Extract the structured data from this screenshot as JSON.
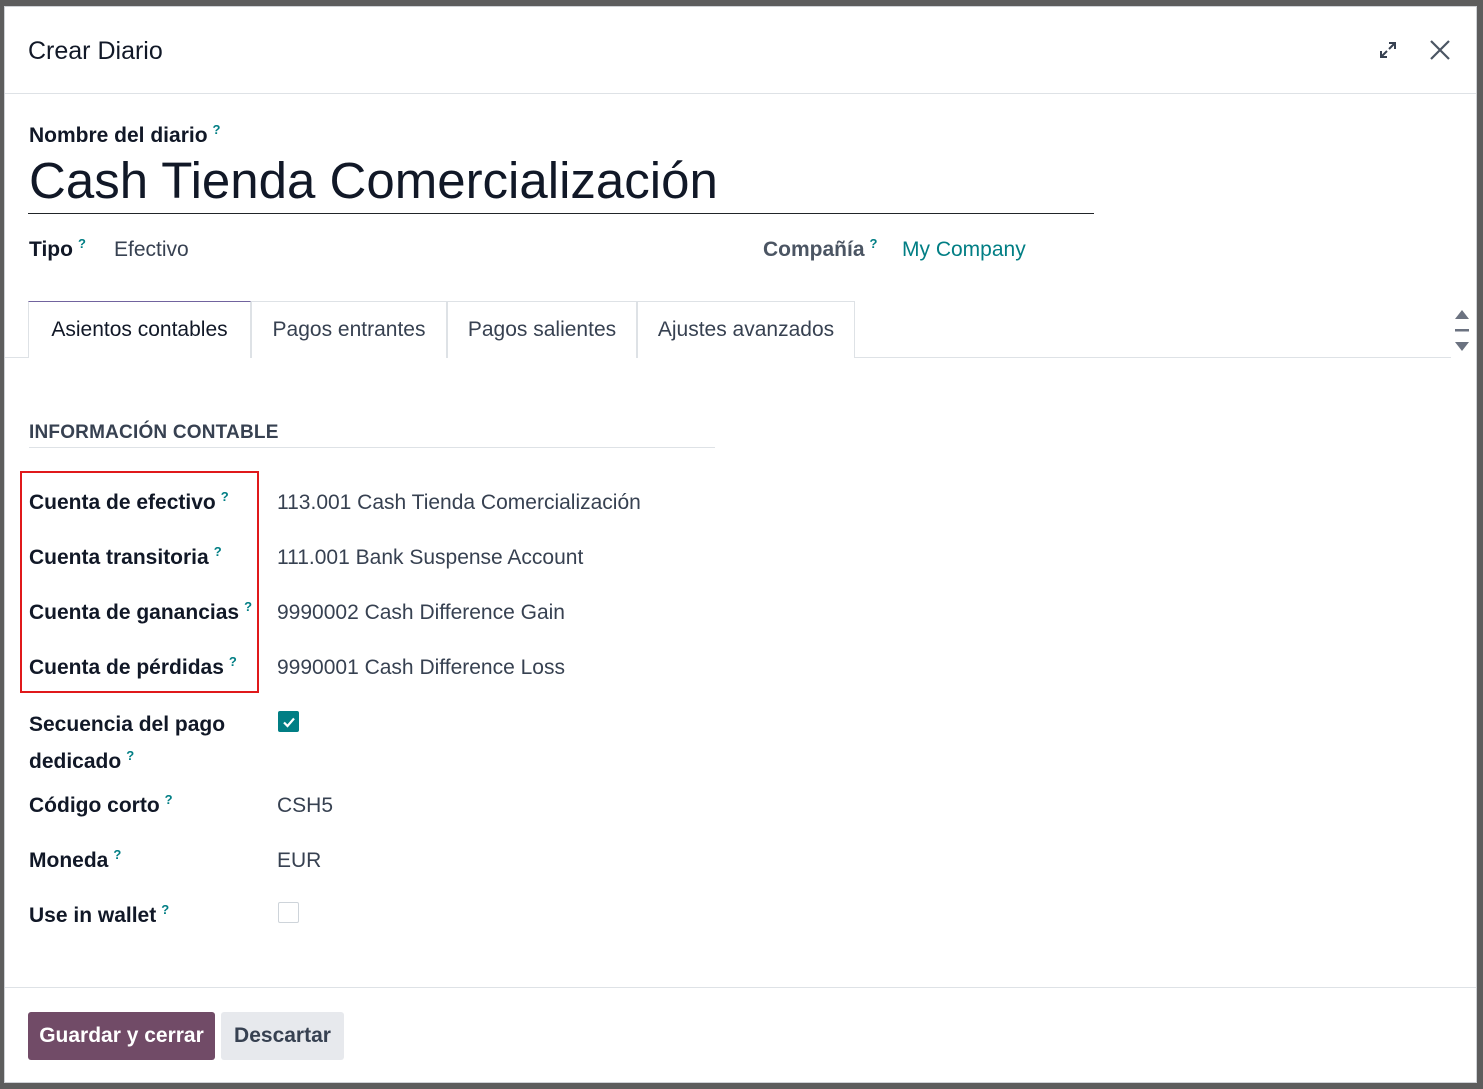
{
  "dialog": {
    "title": "Crear Diario",
    "expand_icon": "expand-icon",
    "close_icon": "close-icon"
  },
  "form": {
    "name_label": "Nombre del diario",
    "name_value": "Cash Tienda Comercialización",
    "tipo_label": "Tipo",
    "tipo_value": "Efectivo",
    "company_label": "Compañía",
    "company_value": "My Company",
    "help_mark": "?"
  },
  "tabs": [
    {
      "label": "Asientos contables",
      "active": true
    },
    {
      "label": "Pagos entrantes",
      "active": false
    },
    {
      "label": "Pagos salientes",
      "active": false
    },
    {
      "label": "Ajustes avanzados",
      "active": false
    }
  ],
  "section": {
    "title": "INFORMACIÓN CONTABLE",
    "fields": {
      "cash_account": {
        "label": "Cuenta de efectivo",
        "value": "113.001 Cash Tienda Comercialización"
      },
      "suspense_account": {
        "label": "Cuenta transitoria",
        "value": "111.001 Bank Suspense Account"
      },
      "profit_account": {
        "label": "Cuenta de ganancias",
        "value": "9990002 Cash Difference Gain"
      },
      "loss_account": {
        "label": "Cuenta de pérdidas",
        "value": "9990001 Cash Difference Loss"
      },
      "dedicated_sequence": {
        "label_line1": "Secuencia del pago",
        "label_line2": "dedicado",
        "checked": true
      },
      "short_code": {
        "label": "Código corto",
        "value": "CSH5"
      },
      "currency": {
        "label": "Moneda",
        "value": "EUR"
      },
      "use_in_wallet": {
        "label": "Use in wallet",
        "checked": false
      }
    }
  },
  "footer": {
    "save_label": "Guardar y cerrar",
    "discard_label": "Descartar"
  },
  "colors": {
    "accent": "#017e84",
    "primary_button": "#714b67",
    "highlight_box": "#e0191b"
  }
}
